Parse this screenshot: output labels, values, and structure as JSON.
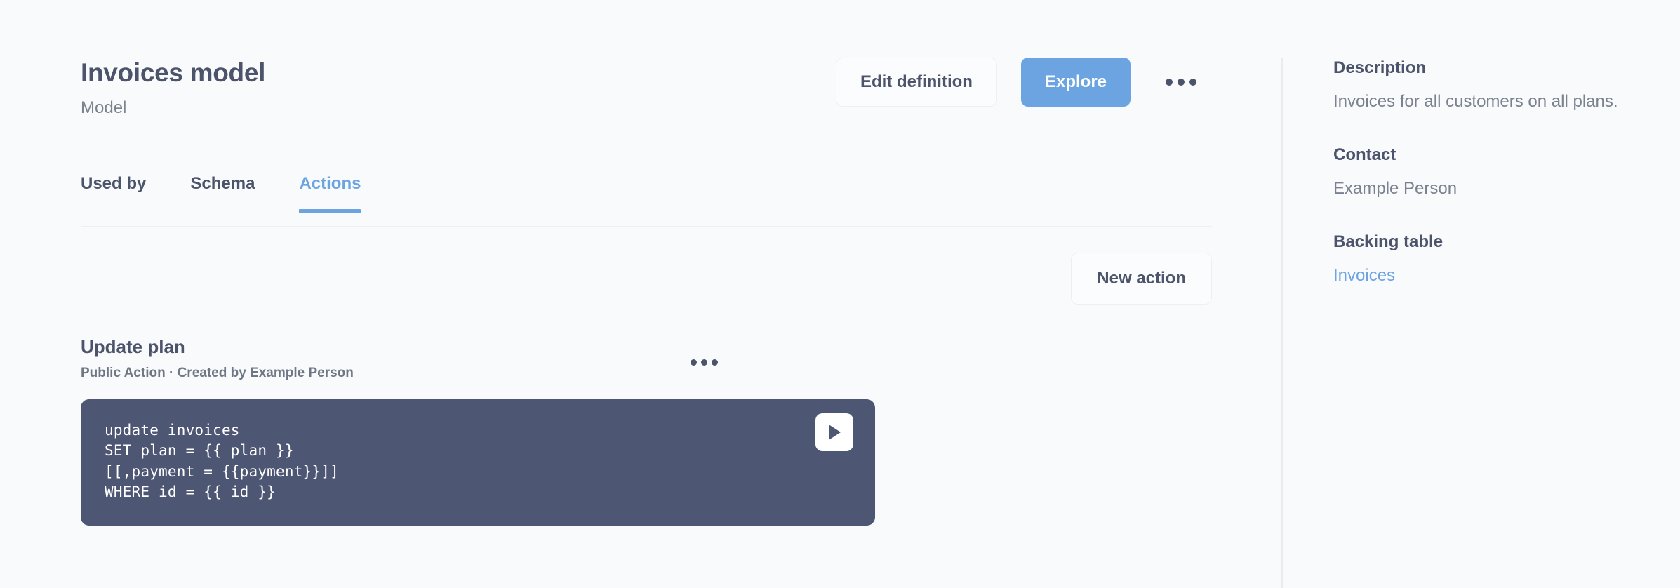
{
  "header": {
    "title": "Invoices model",
    "subtitle": "Model",
    "edit_definition_label": "Edit definition",
    "explore_label": "Explore",
    "more_menu_icon": "ellipsis-horizontal-icon"
  },
  "tabs": [
    {
      "label": "Used by",
      "active": false
    },
    {
      "label": "Schema",
      "active": false
    },
    {
      "label": "Actions",
      "active": true
    }
  ],
  "toolbar": {
    "new_action_label": "New action"
  },
  "action": {
    "title": "Update plan",
    "meta": "Public Action  ·  Created by Example Person",
    "more_menu_icon": "ellipsis-horizontal-icon",
    "run_icon": "play-icon",
    "code": "update invoices\nSET plan = {{ plan }}\n[[,payment = {{payment}}]]\nWHERE id = {{ id }}"
  },
  "sidebar": {
    "description_heading": "Description",
    "description_text": "Invoices for all customers on all plans.",
    "contact_heading": "Contact",
    "contact_text": "Example Person",
    "backing_table_heading": "Backing table",
    "backing_table_link": "Invoices"
  },
  "colors": {
    "page_background": "#F9FAFC",
    "accent_blue": "#6CA4E2",
    "text_primary": "#4C546B",
    "text_secondary": "#7A818F",
    "code_background": "#4D5673",
    "border": "#EDEFF2"
  }
}
